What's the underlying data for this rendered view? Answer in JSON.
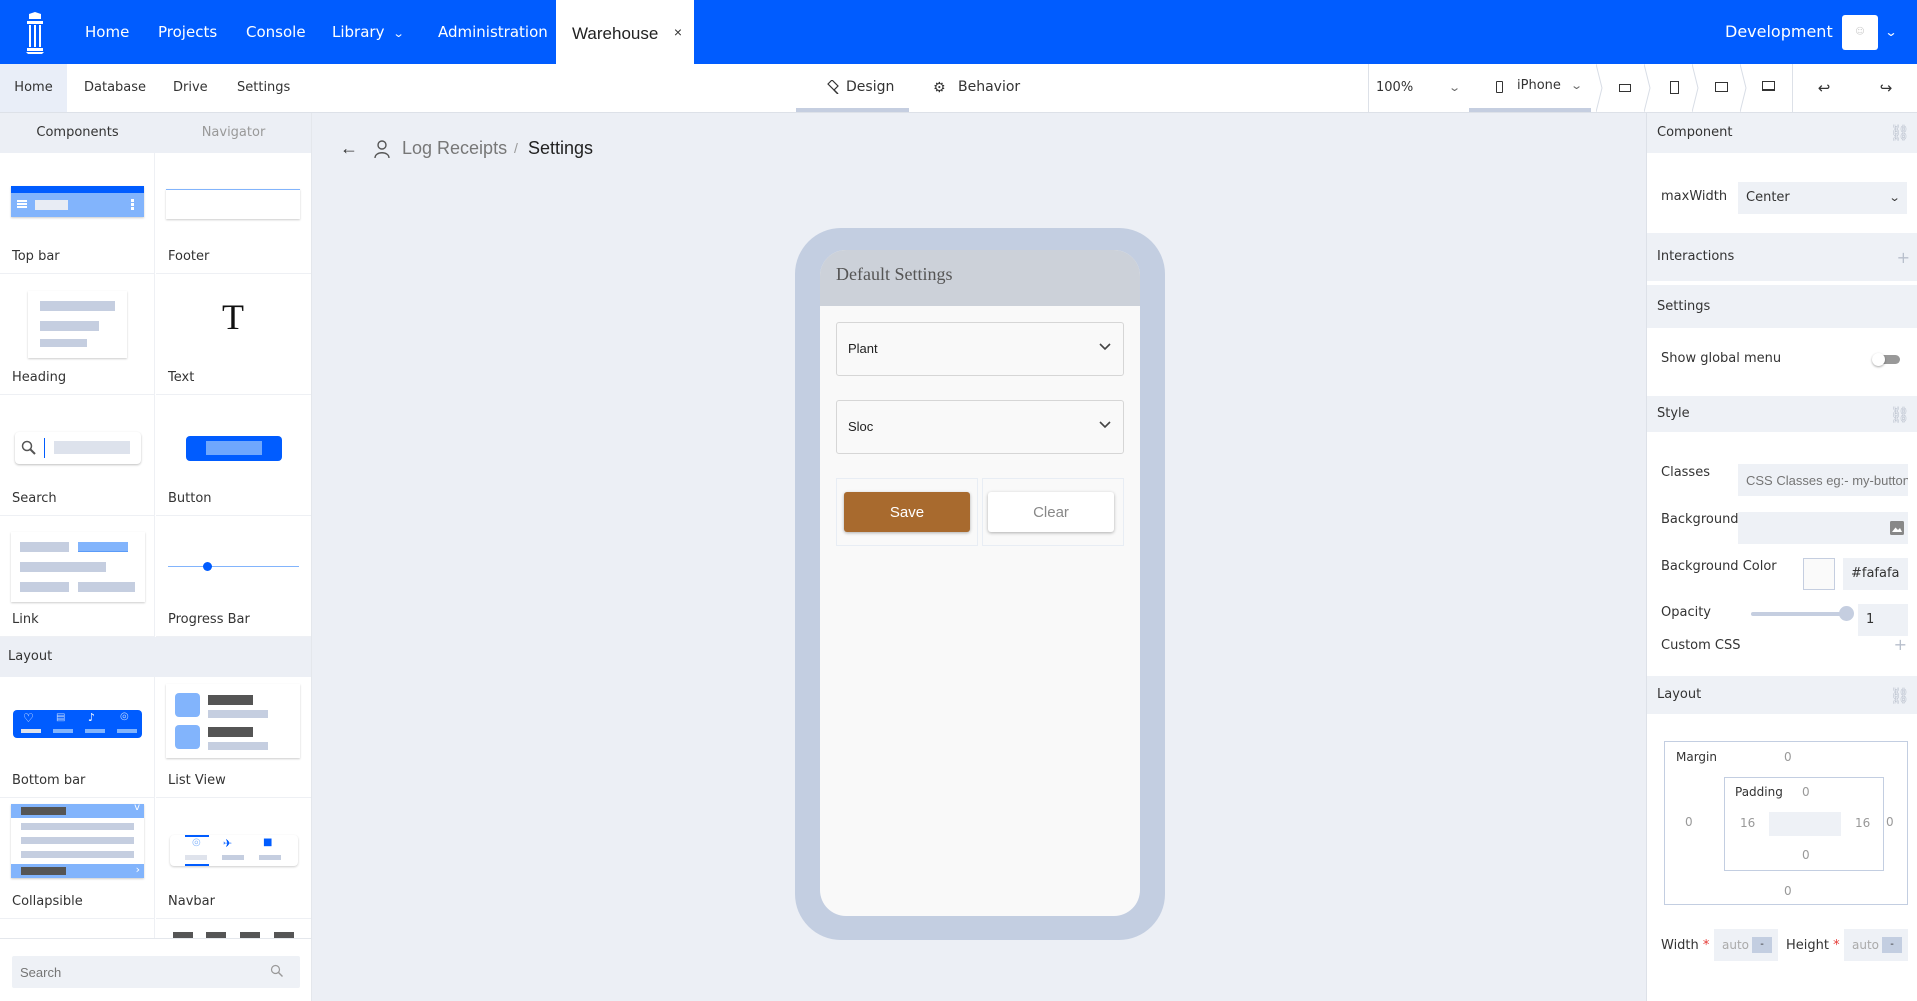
{
  "topbar": {
    "logo": "pillar-logo-icon",
    "nav": [
      {
        "label": "Home"
      },
      {
        "label": "Projects"
      },
      {
        "label": "Console"
      },
      {
        "label": "Library",
        "has_dropdown": true
      },
      {
        "label": "Administration"
      }
    ],
    "open_tab": {
      "label": "Warehouse",
      "close": "×"
    },
    "environment": "Development",
    "environment_chevron": "⌄"
  },
  "subnav": {
    "items": [
      {
        "label": "Home",
        "active": true
      },
      {
        "label": "Database"
      },
      {
        "label": "Drive"
      },
      {
        "label": "Settings"
      }
    ],
    "modes": [
      {
        "label": "Design",
        "active": true
      },
      {
        "label": "Behavior"
      }
    ],
    "zoom": "100%",
    "device": "iPhone",
    "device_buttons": [
      "landscape-phone-icon",
      "portrait-phone-icon",
      "tablet-icon",
      "laptop-icon"
    ],
    "undo": "↩",
    "redo": "↪"
  },
  "leftbar": {
    "tabs": [
      {
        "label": "Components",
        "active": true
      },
      {
        "label": "Navigator"
      }
    ],
    "components": [
      {
        "label": "Top bar"
      },
      {
        "label": "Footer"
      },
      {
        "label": "Heading"
      },
      {
        "label": "Text",
        "glyph": "T"
      },
      {
        "label": "Search"
      },
      {
        "label": "Button"
      },
      {
        "label": "Link"
      },
      {
        "label": "Progress Bar"
      }
    ],
    "layout_section": "Layout",
    "layout_components": [
      {
        "label": "Bottom bar"
      },
      {
        "label": "List View"
      },
      {
        "label": "Collapsible"
      },
      {
        "label": "Navbar"
      }
    ],
    "search_placeholder": "Search"
  },
  "canvas": {
    "breadcrumb": {
      "back": "←",
      "page": "Log Receipts",
      "separator": "/",
      "current": "Settings"
    },
    "phone": {
      "header": "Default Settings",
      "selects": [
        {
          "label": "Plant"
        },
        {
          "label": "Sloc"
        }
      ],
      "buttons": {
        "save": "Save",
        "clear": "Clear",
        "save_color": "#a86a2e"
      }
    }
  },
  "rightbar": {
    "component": {
      "title": "Component",
      "maxwidth_label": "maxWidth",
      "maxwidth_value": "Center"
    },
    "interactions": {
      "title": "Interactions",
      "add": "+"
    },
    "settings": {
      "title": "Settings",
      "show_global_menu_label": "Show global menu",
      "show_global_menu": false
    },
    "style": {
      "title": "Style",
      "classes_label": "Classes",
      "classes_placeholder": "CSS Classes eg:- my-button",
      "background_label": "Background",
      "background_color_label": "Background Color",
      "background_color_value": "#fafafa",
      "opacity_label": "Opacity",
      "opacity_value": "1",
      "opacity_fraction": 1.0,
      "custom_css_label": "Custom CSS",
      "add": "+"
    },
    "layout": {
      "title": "Layout",
      "margin_label": "Margin",
      "margin": {
        "top": "0",
        "right": "0",
        "bottom": "0",
        "left": "0"
      },
      "padding_label": "Padding",
      "padding": {
        "top": "0",
        "right": "16",
        "bottom": "0",
        "left": "16"
      },
      "width_label": "Width",
      "width_value": "auto",
      "height_label": "Height",
      "height_value": "auto",
      "required_mark": "*",
      "unit": "-"
    }
  },
  "colors": {
    "brand_blue": "#005cff",
    "canvas_bg": "#eceff5",
    "phone_frame": "#c3cee1",
    "save_button": "#a86a2e"
  }
}
